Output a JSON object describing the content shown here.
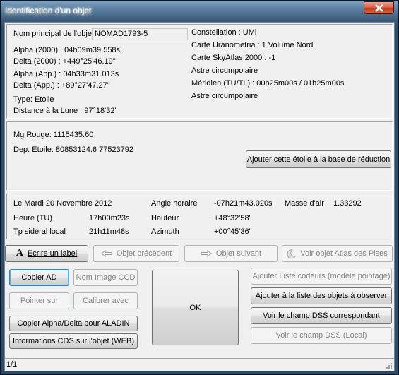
{
  "window": {
    "title": "Identification d'un objet"
  },
  "identity": {
    "name_label": "Nom principal de l'objet",
    "name_value": "NOMAD1793-5",
    "alpha2000": "Alpha (2000) : 04h09m39.558s",
    "delta2000": "Delta (2000) : +449°25'46.19\"",
    "alpha_app": "Alpha (App.) : 04h33m31.013s",
    "delta_app": "Delta (App.) : +89°27'47.27\"",
    "type": "Type: Etoile",
    "moon_distance": "Distance à la Lune : 97°18'32\"",
    "constellation": "Constellation :  UMi",
    "uranometria": "Carte Uranometria : 1  Volume Nord",
    "skyatlas": "Carte SkyAtlas 2000 : -1",
    "circumpolar1": "Astre circumpolaire",
    "meridian": "Méridien (TU/TL) : 00h25m00s / 01h25m00s",
    "circumpolar2": "Astre circumpolaire"
  },
  "magnitude": {
    "mg_rouge": "Mg Rouge: 1115435.60",
    "dep_etoile": "Dep. Etoile: 80853124.6  77523792",
    "add_reduction_button": "Ajouter cette étoile à la base de réduction"
  },
  "ephemeris": {
    "date": "Le Mardi 20 Novembre 2012",
    "heure_label": "Heure (TU)",
    "heure_value": "17h00m23s",
    "tps_label": "Tp sidéral local",
    "tps_value": "21h11m48s",
    "angle_label": "Angle horaire",
    "angle_value": "-07h21m43.020s",
    "hauteur_label": "Hauteur",
    "hauteur_value": "+48°32'58\"",
    "azimuth_label": "Azimuth",
    "azimuth_value": "+00°45'36\"",
    "masse_label": "Masse d'air",
    "masse_value": "1.33292"
  },
  "toolbar": {
    "write_label": "Ecrire un label",
    "prev_object": "Objet précédent",
    "next_object": "Objet suivant",
    "atlas_pises": "Voir objet Atlas des Pises"
  },
  "left_buttons": {
    "copy_ad": "Copier AD",
    "nom_image_ccd": "Nom Image CCD",
    "pointer_sur": "Pointer sur",
    "calibrer_avec": "Calibrer avec",
    "copy_aladin": "Copier Alpha/Delta pour ALADIN",
    "cds_info": "Informations CDS sur l'objet (WEB)"
  },
  "ok_button": "OK",
  "right_buttons": {
    "ajouter_liste_codeurs": "Ajouter Liste codeurs (modèle pointage)",
    "ajouter_liste_observer": "Ajouter à la liste des objets à observer",
    "voir_dss_correspondant": "Voir le champ DSS correspondant",
    "voir_dss_local": "Voir le champ DSS (Local)"
  },
  "status": {
    "page": "1/1"
  }
}
